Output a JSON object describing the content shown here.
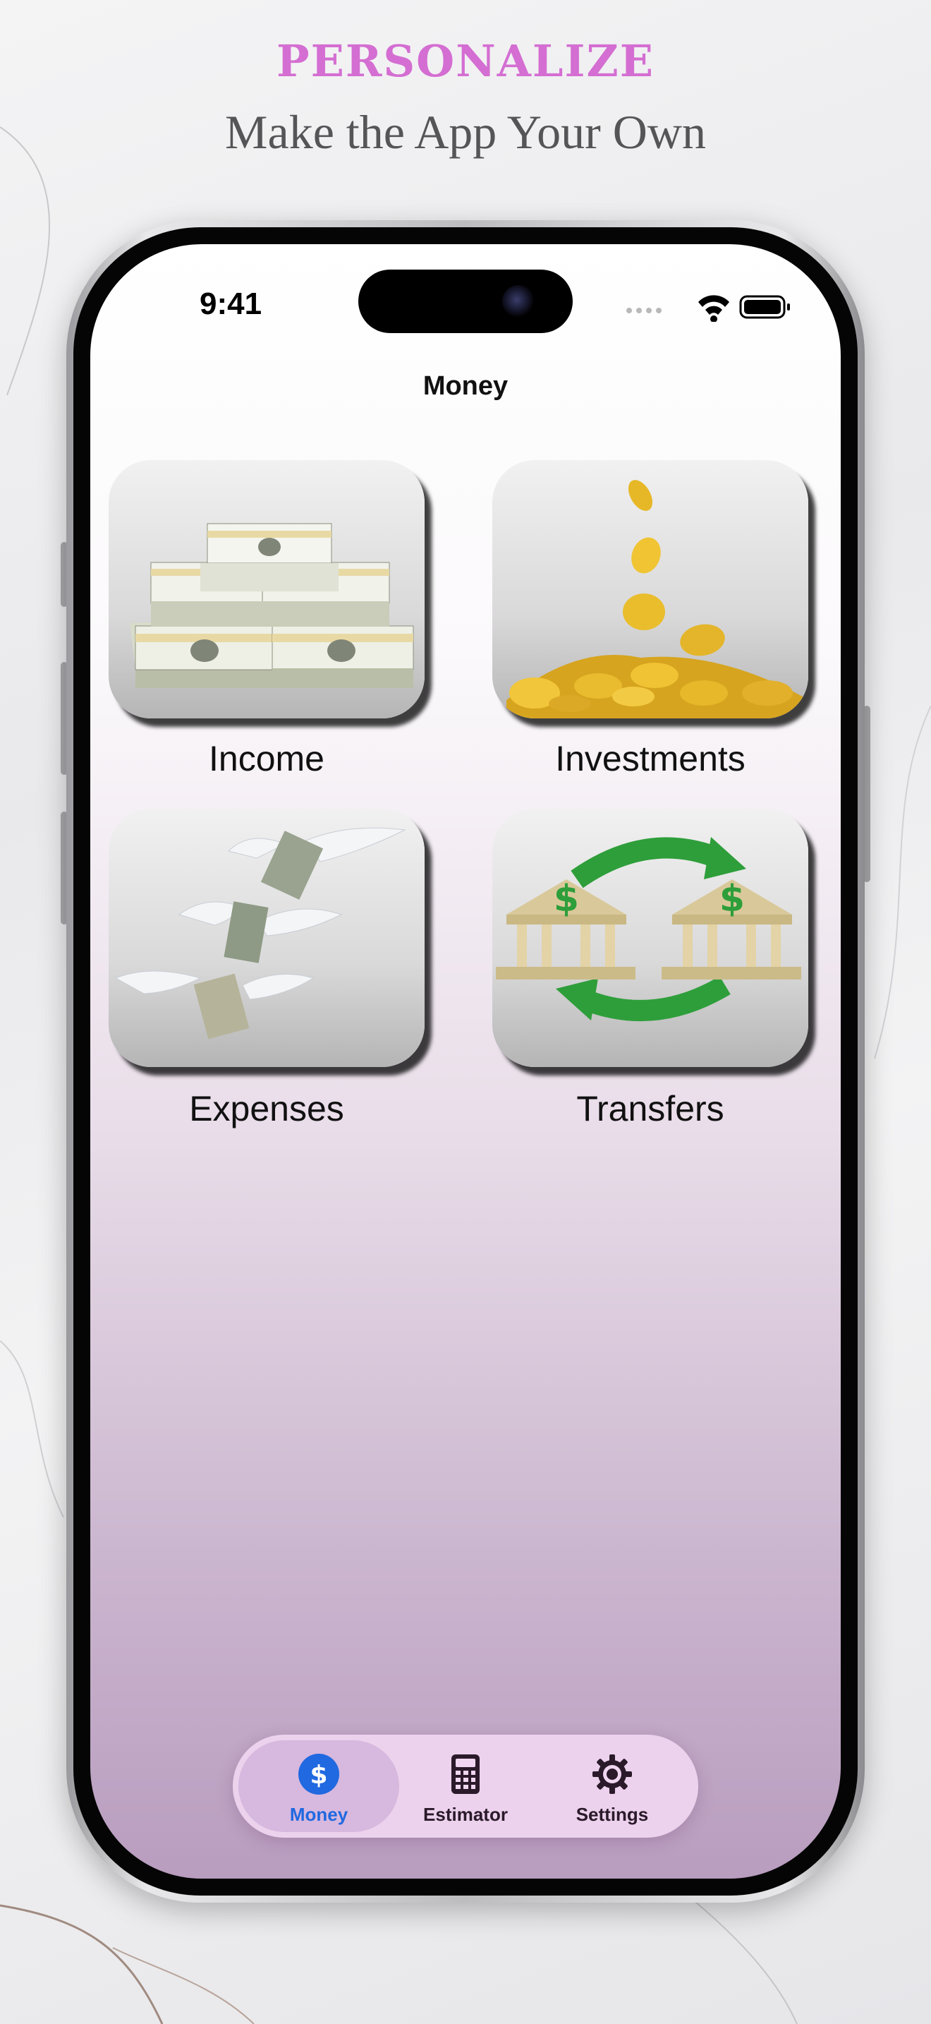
{
  "promo": {
    "headline": "PERSONALIZE",
    "subheadline": "Make the App Your Own"
  },
  "status_bar": {
    "time": "9:41"
  },
  "nav": {
    "title": "Money"
  },
  "tiles": [
    {
      "label": "Income",
      "icon": "money-stacks"
    },
    {
      "label": "Investments",
      "icon": "gold-coins"
    },
    {
      "label": "Expenses",
      "icon": "flying-money"
    },
    {
      "label": "Transfers",
      "icon": "bank-transfer"
    }
  ],
  "tab_bar": {
    "items": [
      {
        "label": "Money",
        "icon": "dollar-icon",
        "selected": true
      },
      {
        "label": "Estimator",
        "icon": "calculator-icon",
        "selected": false
      },
      {
        "label": "Settings",
        "icon": "gear-icon",
        "selected": false
      }
    ]
  },
  "colors": {
    "headline": "#d46ed2",
    "subheadline": "#555558",
    "tab_active": "#2069e0",
    "tabbar_bg": "#f0d6f0",
    "green_arrow": "#2e9e3a"
  }
}
